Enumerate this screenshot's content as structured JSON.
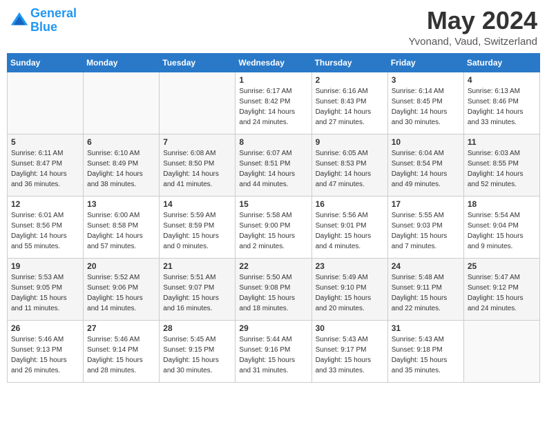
{
  "header": {
    "logo_line1": "General",
    "logo_line2": "Blue",
    "month": "May 2024",
    "location": "Yvonand, Vaud, Switzerland"
  },
  "weekdays": [
    "Sunday",
    "Monday",
    "Tuesday",
    "Wednesday",
    "Thursday",
    "Friday",
    "Saturday"
  ],
  "weeks": [
    [
      {
        "day": "",
        "info": ""
      },
      {
        "day": "",
        "info": ""
      },
      {
        "day": "",
        "info": ""
      },
      {
        "day": "1",
        "info": "Sunrise: 6:17 AM\nSunset: 8:42 PM\nDaylight: 14 hours\nand 24 minutes."
      },
      {
        "day": "2",
        "info": "Sunrise: 6:16 AM\nSunset: 8:43 PM\nDaylight: 14 hours\nand 27 minutes."
      },
      {
        "day": "3",
        "info": "Sunrise: 6:14 AM\nSunset: 8:45 PM\nDaylight: 14 hours\nand 30 minutes."
      },
      {
        "day": "4",
        "info": "Sunrise: 6:13 AM\nSunset: 8:46 PM\nDaylight: 14 hours\nand 33 minutes."
      }
    ],
    [
      {
        "day": "5",
        "info": "Sunrise: 6:11 AM\nSunset: 8:47 PM\nDaylight: 14 hours\nand 36 minutes."
      },
      {
        "day": "6",
        "info": "Sunrise: 6:10 AM\nSunset: 8:49 PM\nDaylight: 14 hours\nand 38 minutes."
      },
      {
        "day": "7",
        "info": "Sunrise: 6:08 AM\nSunset: 8:50 PM\nDaylight: 14 hours\nand 41 minutes."
      },
      {
        "day": "8",
        "info": "Sunrise: 6:07 AM\nSunset: 8:51 PM\nDaylight: 14 hours\nand 44 minutes."
      },
      {
        "day": "9",
        "info": "Sunrise: 6:05 AM\nSunset: 8:53 PM\nDaylight: 14 hours\nand 47 minutes."
      },
      {
        "day": "10",
        "info": "Sunrise: 6:04 AM\nSunset: 8:54 PM\nDaylight: 14 hours\nand 49 minutes."
      },
      {
        "day": "11",
        "info": "Sunrise: 6:03 AM\nSunset: 8:55 PM\nDaylight: 14 hours\nand 52 minutes."
      }
    ],
    [
      {
        "day": "12",
        "info": "Sunrise: 6:01 AM\nSunset: 8:56 PM\nDaylight: 14 hours\nand 55 minutes."
      },
      {
        "day": "13",
        "info": "Sunrise: 6:00 AM\nSunset: 8:58 PM\nDaylight: 14 hours\nand 57 minutes."
      },
      {
        "day": "14",
        "info": "Sunrise: 5:59 AM\nSunset: 8:59 PM\nDaylight: 15 hours\nand 0 minutes."
      },
      {
        "day": "15",
        "info": "Sunrise: 5:58 AM\nSunset: 9:00 PM\nDaylight: 15 hours\nand 2 minutes."
      },
      {
        "day": "16",
        "info": "Sunrise: 5:56 AM\nSunset: 9:01 PM\nDaylight: 15 hours\nand 4 minutes."
      },
      {
        "day": "17",
        "info": "Sunrise: 5:55 AM\nSunset: 9:03 PM\nDaylight: 15 hours\nand 7 minutes."
      },
      {
        "day": "18",
        "info": "Sunrise: 5:54 AM\nSunset: 9:04 PM\nDaylight: 15 hours\nand 9 minutes."
      }
    ],
    [
      {
        "day": "19",
        "info": "Sunrise: 5:53 AM\nSunset: 9:05 PM\nDaylight: 15 hours\nand 11 minutes."
      },
      {
        "day": "20",
        "info": "Sunrise: 5:52 AM\nSunset: 9:06 PM\nDaylight: 15 hours\nand 14 minutes."
      },
      {
        "day": "21",
        "info": "Sunrise: 5:51 AM\nSunset: 9:07 PM\nDaylight: 15 hours\nand 16 minutes."
      },
      {
        "day": "22",
        "info": "Sunrise: 5:50 AM\nSunset: 9:08 PM\nDaylight: 15 hours\nand 18 minutes."
      },
      {
        "day": "23",
        "info": "Sunrise: 5:49 AM\nSunset: 9:10 PM\nDaylight: 15 hours\nand 20 minutes."
      },
      {
        "day": "24",
        "info": "Sunrise: 5:48 AM\nSunset: 9:11 PM\nDaylight: 15 hours\nand 22 minutes."
      },
      {
        "day": "25",
        "info": "Sunrise: 5:47 AM\nSunset: 9:12 PM\nDaylight: 15 hours\nand 24 minutes."
      }
    ],
    [
      {
        "day": "26",
        "info": "Sunrise: 5:46 AM\nSunset: 9:13 PM\nDaylight: 15 hours\nand 26 minutes."
      },
      {
        "day": "27",
        "info": "Sunrise: 5:46 AM\nSunset: 9:14 PM\nDaylight: 15 hours\nand 28 minutes."
      },
      {
        "day": "28",
        "info": "Sunrise: 5:45 AM\nSunset: 9:15 PM\nDaylight: 15 hours\nand 30 minutes."
      },
      {
        "day": "29",
        "info": "Sunrise: 5:44 AM\nSunset: 9:16 PM\nDaylight: 15 hours\nand 31 minutes."
      },
      {
        "day": "30",
        "info": "Sunrise: 5:43 AM\nSunset: 9:17 PM\nDaylight: 15 hours\nand 33 minutes."
      },
      {
        "day": "31",
        "info": "Sunrise: 5:43 AM\nSunset: 9:18 PM\nDaylight: 15 hours\nand 35 minutes."
      },
      {
        "day": "",
        "info": ""
      }
    ]
  ]
}
